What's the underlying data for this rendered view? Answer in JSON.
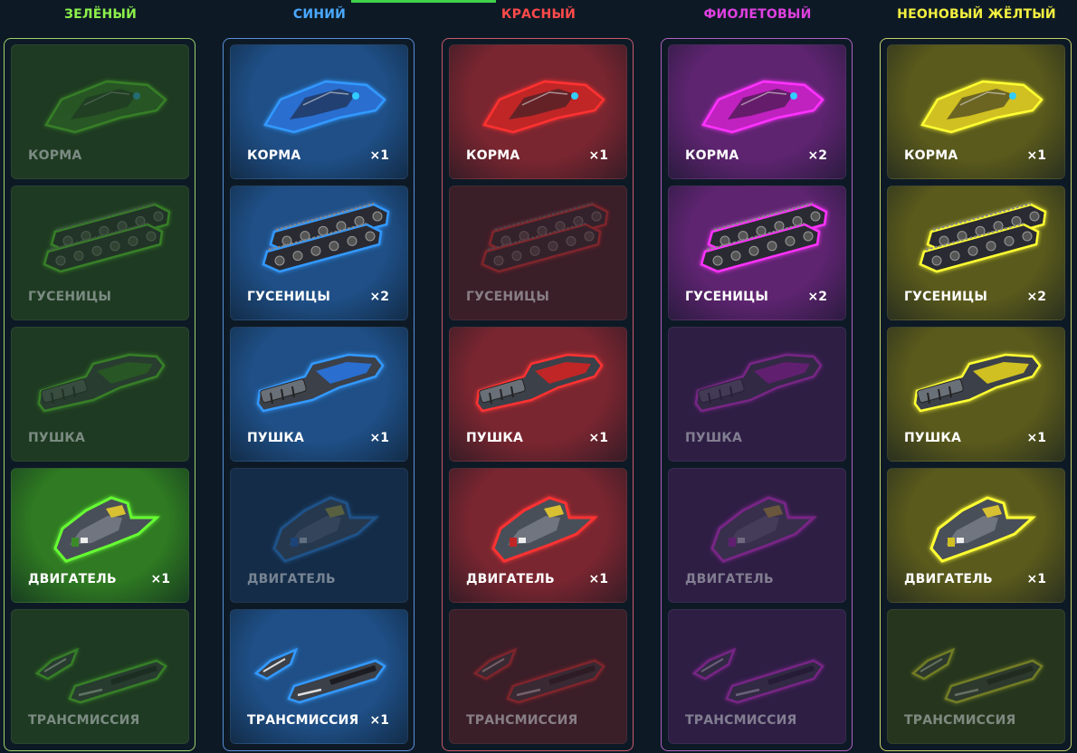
{
  "columns": [
    {
      "title": "ЗЕЛЁНЫЙ",
      "colors": {
        "title": "#8cf04a",
        "frame": "#9ad06a",
        "card_on": "#2f7a22",
        "card_off": "#1e3a22",
        "glow": "#66ff33",
        "body": "#3a8a2a"
      },
      "items": [
        {
          "label": "КОРМА",
          "count": "",
          "owned": false,
          "icon": "hull-icon"
        },
        {
          "label": "ГУСЕНИЦЫ",
          "count": "",
          "owned": false,
          "icon": "tracks-icon"
        },
        {
          "label": "ПУШКА",
          "count": "",
          "owned": false,
          "icon": "cannon-icon"
        },
        {
          "label": "ДВИГАТЕЛЬ",
          "count": "×1",
          "owned": true,
          "icon": "engine-icon"
        },
        {
          "label": "ТРАНСМИССИЯ",
          "count": "",
          "owned": false,
          "icon": "transmission-icon"
        }
      ]
    },
    {
      "title": "СИНИЙ",
      "colors": {
        "title": "#4aa8ff",
        "frame": "#5a8ed8",
        "card_on": "#1f4f86",
        "card_off": "#142c48",
        "glow": "#3399ff",
        "body": "#2a6ed0"
      },
      "items": [
        {
          "label": "КОРМА",
          "count": "×1",
          "owned": true,
          "icon": "hull-icon"
        },
        {
          "label": "ГУСЕНИЦЫ",
          "count": "×2",
          "owned": true,
          "icon": "tracks-icon"
        },
        {
          "label": "ПУШКА",
          "count": "×1",
          "owned": true,
          "icon": "cannon-icon"
        },
        {
          "label": "ДВИГАТЕЛЬ",
          "count": "",
          "owned": false,
          "icon": "engine-icon"
        },
        {
          "label": "ТРАНСМИССИЯ",
          "count": "×1",
          "owned": true,
          "icon": "transmission-icon"
        }
      ]
    },
    {
      "title": "КРАСНЫЙ",
      "colors": {
        "title": "#ff4a4a",
        "frame": "#c85a6a",
        "card_on": "#7a2630",
        "card_off": "#3a1e28",
        "glow": "#ff3030",
        "body": "#c02828"
      },
      "items": [
        {
          "label": "КОРМА",
          "count": "×1",
          "owned": true,
          "icon": "hull-icon"
        },
        {
          "label": "ГУСЕНИЦЫ",
          "count": "",
          "owned": false,
          "icon": "tracks-icon"
        },
        {
          "label": "ПУШКА",
          "count": "×1",
          "owned": true,
          "icon": "cannon-icon"
        },
        {
          "label": "ДВИГАТЕЛЬ",
          "count": "×1",
          "owned": true,
          "icon": "engine-icon"
        },
        {
          "label": "ТРАНСМИССИЯ",
          "count": "",
          "owned": false,
          "icon": "transmission-icon"
        }
      ]
    },
    {
      "title": "ФИОЛЕТОВЫЙ",
      "colors": {
        "title": "#e040e0",
        "frame": "#b060c0",
        "card_on": "#5e2470",
        "card_off": "#2e1e44",
        "glow": "#ff33ff",
        "body": "#c020c0"
      },
      "items": [
        {
          "label": "КОРМА",
          "count": "×2",
          "owned": true,
          "icon": "hull-icon"
        },
        {
          "label": "ГУСЕНИЦЫ",
          "count": "×2",
          "owned": true,
          "icon": "tracks-icon"
        },
        {
          "label": "ПУШКА",
          "count": "",
          "owned": false,
          "icon": "cannon-icon"
        },
        {
          "label": "ДВИГАТЕЛЬ",
          "count": "",
          "owned": false,
          "icon": "engine-icon"
        },
        {
          "label": "ТРАНСМИССИЯ",
          "count": "",
          "owned": false,
          "icon": "transmission-icon"
        }
      ]
    },
    {
      "title": "НЕОНОВЫЙ ЖЁЛТЫЙ",
      "colors": {
        "title": "#f4f040",
        "frame": "#c8d06a",
        "card_on": "#5a5a1c",
        "card_off": "#26361e",
        "glow": "#ffff33",
        "body": "#d0c020"
      },
      "items": [
        {
          "label": "КОРМА",
          "count": "×1",
          "owned": true,
          "icon": "hull-icon"
        },
        {
          "label": "ГУСЕНИЦЫ",
          "count": "×2",
          "owned": true,
          "icon": "tracks-icon"
        },
        {
          "label": "ПУШКА",
          "count": "×1",
          "owned": true,
          "icon": "cannon-icon"
        },
        {
          "label": "ДВИГАТЕЛЬ",
          "count": "×1",
          "owned": true,
          "icon": "engine-icon"
        },
        {
          "label": "ТРАНСМИССИЯ",
          "count": "",
          "owned": false,
          "icon": "transmission-icon"
        }
      ]
    }
  ]
}
